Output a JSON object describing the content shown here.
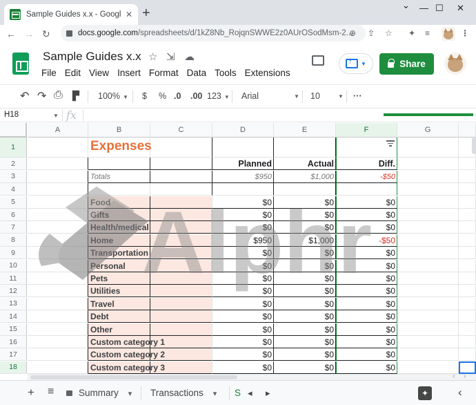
{
  "browser": {
    "tab_title": "Sample Guides x.x - Google Shee",
    "tab_close": "✕",
    "new_tab": "+",
    "controls": {
      "minimize": "—",
      "maximize": "☐",
      "close": "✕",
      "caret": "⌄"
    },
    "nav": {
      "back": "←",
      "forward": "→",
      "reload": "↻"
    },
    "url_host": "docs.google.com",
    "url_path": "/spreadsheets/d/1kZ8Nb_RojqnSWWE2z0AUrOSodMsm-2...",
    "url_icons": {
      "zoom": "⊕",
      "share": "⇪",
      "star": "☆",
      "extensions": "✦",
      "media": "≡"
    }
  },
  "doc": {
    "title": "Sample Guides x.x",
    "title_icons": {
      "star": "☆",
      "move": "⇲",
      "cloud": "☁"
    },
    "menus": [
      "File",
      "Edit",
      "View",
      "Insert",
      "Format",
      "Data",
      "Tools",
      "Extensions"
    ],
    "share_label": "Share"
  },
  "toolbar": {
    "undo": "↶",
    "redo": "↷",
    "print": "⎙",
    "paint": "▛",
    "zoom": "100%",
    "currency": "$",
    "percent": "%",
    "dec_less": ".0",
    "dec_more": ".00",
    "number_format": "123",
    "font": "Arial",
    "font_size": "10",
    "more": "···",
    "caret": "▼"
  },
  "formula_bar": {
    "name_box": "H18",
    "fx": "fx"
  },
  "grid": {
    "columns": [
      "A",
      "B",
      "C",
      "D",
      "E",
      "F",
      "G"
    ],
    "rows": [
      "1",
      "2",
      "3",
      "4",
      "5",
      "6",
      "7",
      "8",
      "9",
      "10",
      "11",
      "12",
      "13",
      "14",
      "15",
      "16",
      "17",
      "18"
    ],
    "title": "Expenses",
    "headers": {
      "planned": "Planned",
      "actual": "Actual",
      "diff": "Diff."
    },
    "totals": {
      "label": "Totals",
      "planned": "$950",
      "actual": "$1,000",
      "diff": "-$50"
    },
    "categories": [
      {
        "name": "Food",
        "planned": "$0",
        "actual": "$0",
        "diff": "$0"
      },
      {
        "name": "Gifts",
        "planned": "$0",
        "actual": "$0",
        "diff": "$0"
      },
      {
        "name": "Health/medical",
        "planned": "$0",
        "actual": "$0",
        "diff": "$0"
      },
      {
        "name": "Home",
        "planned": "$950",
        "actual": "$1,000",
        "diff": "-$50"
      },
      {
        "name": "Transportation",
        "planned": "$0",
        "actual": "$0",
        "diff": "$0"
      },
      {
        "name": "Personal",
        "planned": "$0",
        "actual": "$0",
        "diff": "$0"
      },
      {
        "name": "Pets",
        "planned": "$0",
        "actual": "$0",
        "diff": "$0"
      },
      {
        "name": "Utilities",
        "planned": "$0",
        "actual": "$0",
        "diff": "$0"
      },
      {
        "name": "Travel",
        "planned": "$0",
        "actual": "$0",
        "diff": "$0"
      },
      {
        "name": "Debt",
        "planned": "$0",
        "actual": "$0",
        "diff": "$0"
      },
      {
        "name": "Other",
        "planned": "$0",
        "actual": "$0",
        "diff": "$0"
      },
      {
        "name": "Custom category 1",
        "planned": "$0",
        "actual": "$0",
        "diff": "$0"
      },
      {
        "name": "Custom category 2",
        "planned": "$0",
        "actual": "$0",
        "diff": "$0"
      },
      {
        "name": "Custom category 3",
        "planned": "$0",
        "actual": "$0",
        "diff": "$0"
      }
    ]
  },
  "sheet_tabs": {
    "add": "+",
    "all_sheets": "≡",
    "tabs": [
      "Summary",
      "Transactions"
    ],
    "partial_tab": "S",
    "caret": "▾",
    "prev": "◂",
    "next": "▸",
    "explore": "✦",
    "collapse": "‹",
    "scroll_left": "‹",
    "scroll_right": "›"
  },
  "watermark": {
    "text": "Alphr"
  },
  "colors": {
    "accent_green": "#1e8e3e",
    "title_orange": "#e8703a",
    "category_fill": "#fce8e1",
    "negative": "#d93025"
  }
}
